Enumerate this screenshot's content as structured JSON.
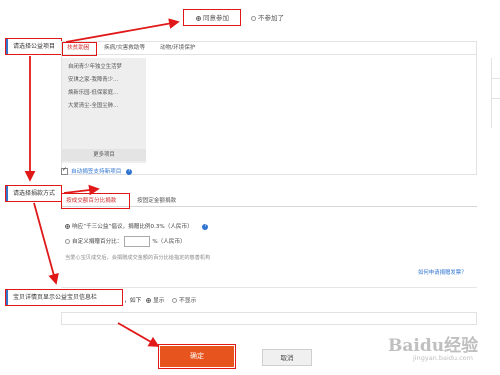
{
  "participate": {
    "join_label": "同意参加",
    "decline_label": "不参加了"
  },
  "project_section": {
    "label": "请选择公益项目",
    "tabs": [
      {
        "label": "扶贫助困"
      },
      {
        "label": "疾病/灾害救助等"
      },
      {
        "label": "动物/环境保护"
      }
    ],
    "items": [
      "自闭青少年独立生活梦",
      "安琪之家-我障青少...",
      "焕新乐园-低保家庭...",
      "大爱清尘-全国尘肺..."
    ],
    "more_label": "更多项目",
    "auto_checkbox_label": "自动捐签支持新项目"
  },
  "donation_section": {
    "label": "请选择捐款方式",
    "tabs": [
      {
        "label": "按成交额百分比捐款"
      },
      {
        "label": "按固定金额捐款"
      }
    ],
    "option1_text": "响应“千三公益”倡议，捐赠比例0.3%（人民币）",
    "option2_prefix": "自定义捐赠百分比：",
    "option2_suffix": "%（人民币）",
    "note": "当爱心宝贝成交后，会捐赠成交金额的百分比给指定的慈善机构",
    "how_to_link": "如何申请捐赠发票？"
  },
  "display_section": {
    "label": "宝贝详情页显示公益宝贝信息栏",
    "suffix": "，如下",
    "show_label": "显示",
    "hide_label": "不显示"
  },
  "actions": {
    "confirm_label": "确定",
    "cancel_label": "取消"
  },
  "watermark": {
    "brand": "Baidu经验",
    "url": "jingyan.baidu.com"
  },
  "colors": {
    "accent": "#e8541e",
    "annotation_red": "#e01818",
    "link_blue": "#2f74d0",
    "tab_active": "#d12c2c"
  }
}
